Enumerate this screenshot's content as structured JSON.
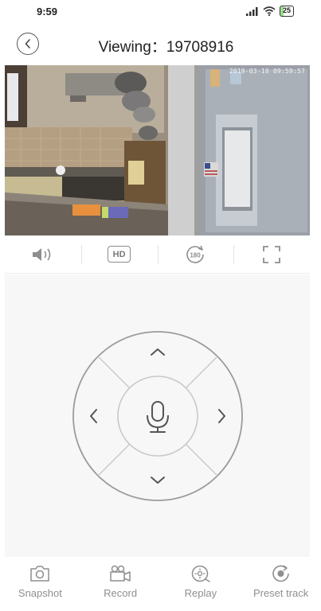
{
  "status_bar": {
    "time": "9:59",
    "battery": "25"
  },
  "header": {
    "title": "Viewing：19708916"
  },
  "video": {
    "timestamp": "2019-03-10 09:59:57"
  },
  "toolbar": {
    "hd_label": "HD",
    "rotate_label": "180"
  },
  "bottom_nav": {
    "items": [
      {
        "label": "Snapshot",
        "icon": "camera-icon"
      },
      {
        "label": "Record",
        "icon": "video-camera-icon"
      },
      {
        "label": "Replay",
        "icon": "replay-icon"
      },
      {
        "label": "Preset track",
        "icon": "preset-track-icon"
      }
    ]
  }
}
